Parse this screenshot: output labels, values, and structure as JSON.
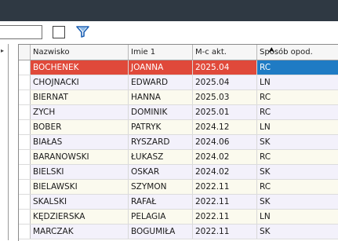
{
  "columns": [
    "Nazwisko",
    "Imie 1",
    "M-c akt.",
    "Sposób opod."
  ],
  "rows": [
    [
      "BOCHENEK",
      "JOANNA",
      "2025.04",
      "RC"
    ],
    [
      "CHOJNACKI",
      "EDWARD",
      "2025.04",
      "LN"
    ],
    [
      "BIERNAT",
      "HANNA",
      "2025.03",
      "RC"
    ],
    [
      "ZYCH",
      "DOMINIK",
      "2025.01",
      "RC"
    ],
    [
      "BOBER",
      "PATRYK",
      "2024.12",
      "LN"
    ],
    [
      "BIAŁAS",
      "RYSZARD",
      "2024.06",
      "SK"
    ],
    [
      "BARANOWSKI",
      "ŁUKASZ",
      "2024.02",
      "RC"
    ],
    [
      "BIELSKI",
      "OSKAR",
      "2024.02",
      "SK"
    ],
    [
      "BIELAWSKI",
      "SZYMON",
      "2022.11",
      "RC"
    ],
    [
      "SKALSKI",
      "RAFAŁ",
      "2022.11",
      "SK"
    ],
    [
      "KĘDZIERSKA",
      "PELAGIA",
      "2022.11",
      "LN"
    ],
    [
      "MARCZAK",
      "BOGUMIŁA",
      "2022.11",
      "SK"
    ]
  ],
  "selected_row": 0,
  "colors": {
    "selected_bg": "#e0493a",
    "selected_last_bg": "#1f7bc4",
    "row_odd": "#f3f1fb",
    "row_even": "#fbfaee",
    "titlebar": "#2f3943"
  },
  "icons": {
    "filter": "filter-funnel-icon",
    "sort": "sort-ascending-icon",
    "nav": "chevron-right-icon"
  }
}
